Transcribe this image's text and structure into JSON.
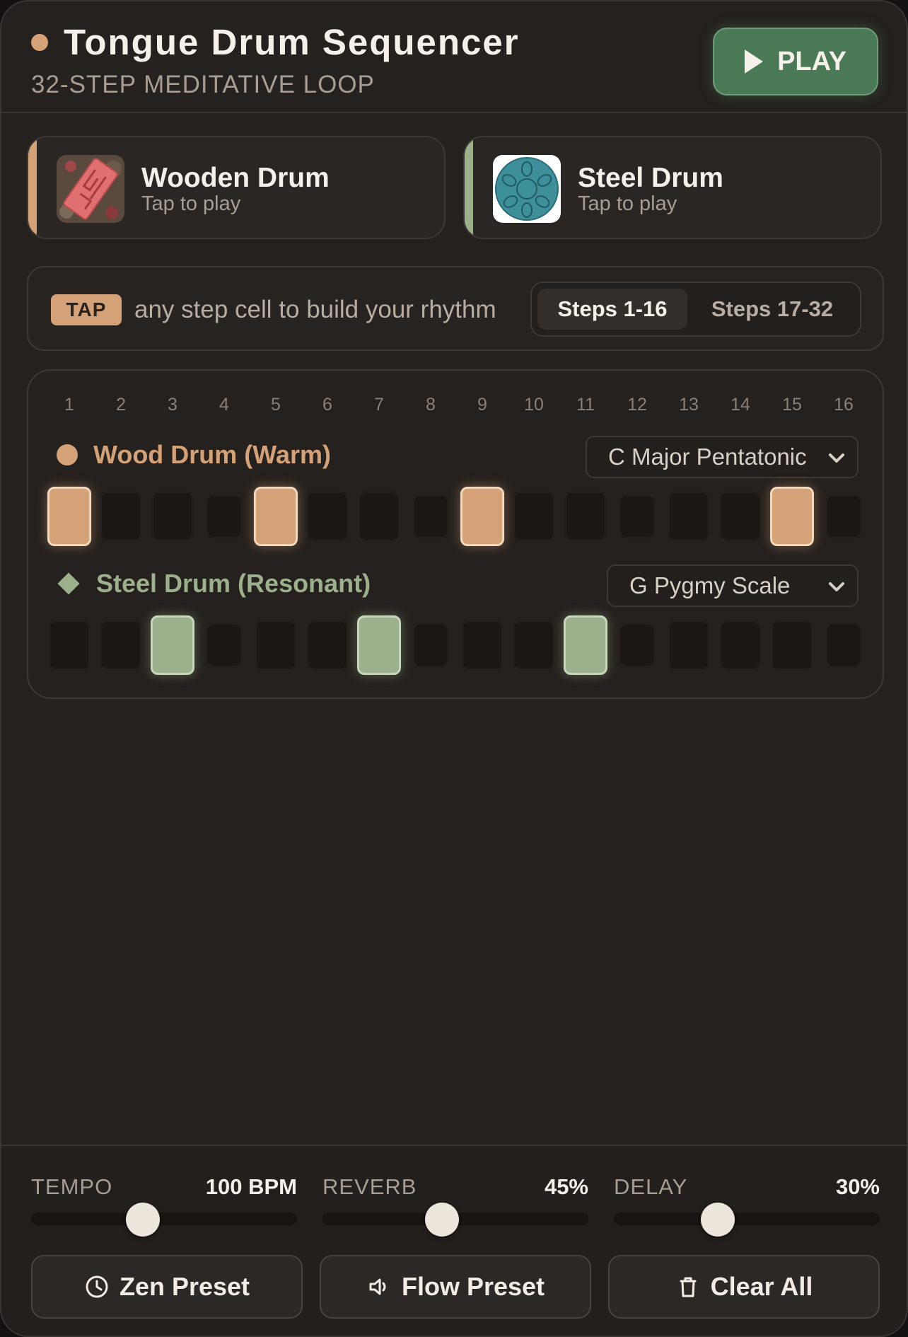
{
  "header": {
    "title": "Tongue Drum Sequencer",
    "subtitle": "32-STEP MEDITATIVE LOOP",
    "play_label": "PLAY"
  },
  "instruments": [
    {
      "name": "Wooden Drum",
      "sub": "Tap to play",
      "icon": "wooden-drum-photo"
    },
    {
      "name": "Steel Drum",
      "sub": "Tap to play",
      "icon": "steel-drum-photo"
    }
  ],
  "hint": {
    "badge": "TAP",
    "text": "any step cell to build your rhythm",
    "pages": [
      "Steps 1-16",
      "Steps 17-32"
    ],
    "active_page": 0
  },
  "sequencer": {
    "step_numbers": [
      "1",
      "2",
      "3",
      "4",
      "5",
      "6",
      "7",
      "8",
      "9",
      "10",
      "11",
      "12",
      "13",
      "14",
      "15",
      "16"
    ],
    "tracks": [
      {
        "name": "Wood Drum (Warm)",
        "scale": "C Major Pentatonic",
        "color": "#d4a276",
        "steps": [
          1,
          0,
          0,
          0,
          1,
          0,
          0,
          0,
          1,
          0,
          0,
          0,
          0,
          0,
          1,
          0
        ]
      },
      {
        "name": "Steel Drum (Resonant)",
        "scale": "G Pygmy Scale",
        "color": "#9bb08b",
        "steps": [
          0,
          0,
          1,
          0,
          0,
          0,
          1,
          0,
          0,
          0,
          1,
          0,
          0,
          0,
          0,
          0
        ]
      }
    ]
  },
  "controls": {
    "tempo": {
      "label": "TEMPO",
      "value_text": "100 BPM",
      "level": 0.42
    },
    "reverb": {
      "label": "REVERB",
      "value_text": "45%",
      "level": 0.45
    },
    "delay": {
      "label": "DELAY",
      "value_text": "30%",
      "level": 0.39
    }
  },
  "presets": {
    "zen": "Zen Preset",
    "flow": "Flow Preset",
    "clear": "Clear All"
  },
  "colors": {
    "accent_wood": "#d4a276",
    "accent_steel": "#9bb08b",
    "play_green": "#4a7a55"
  }
}
